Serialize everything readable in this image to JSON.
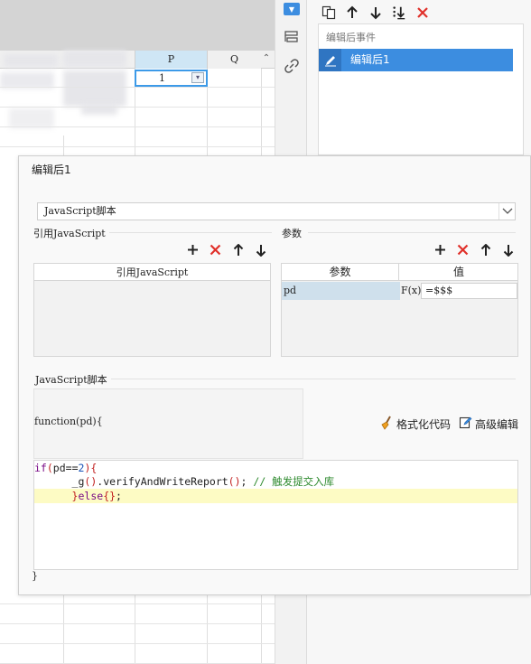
{
  "sheet": {
    "columns": [
      "P",
      "Q"
    ],
    "active_cell_value": "1",
    "scroll_up_glyph": "⌃"
  },
  "side_toolbar": {
    "icons": [
      "dropdown-widget-icon",
      "layers-icon",
      "link-icon"
    ]
  },
  "event_panel": {
    "toolbar_icons": [
      "copy-icon",
      "move-up-icon",
      "move-down-icon",
      "move-bottom-icon",
      "delete-icon"
    ],
    "header": "编辑后事件",
    "items": [
      {
        "label": "编辑后1"
      }
    ]
  },
  "dialog": {
    "title": "编辑后1",
    "type_select": {
      "value": "JavaScript脚本"
    },
    "ref_section": {
      "label": "引用JavaScript",
      "column_header": "引用JavaScript",
      "tools": [
        "+",
        "✕",
        "↑",
        "↓"
      ]
    },
    "param_section": {
      "label": "参数",
      "column_headers": [
        "参数",
        "值"
      ],
      "rows": [
        {
          "name": "pd",
          "fx": "F(x)",
          "value": "=$$$"
        }
      ],
      "tools": [
        "+",
        "✕",
        "↑",
        "↓"
      ]
    },
    "script_section": {
      "label": "JavaScript脚本",
      "function_signature": "function(pd){",
      "format_button": "格式化代码",
      "advanced_button": "高级编辑",
      "closing": "}"
    },
    "code": {
      "line1": {
        "kw": "if",
        "p1": "(",
        "t1": "pd==",
        "n1": "2",
        "p2": "){"
      },
      "line2": {
        "indent": "      ",
        "t1": "_g",
        "p1": "()",
        "t2": ".verifyAndWriteReport",
        "p2": "()",
        "t3": "; ",
        "comment": "// 触发提交入库"
      },
      "line3": {
        "indent": "      ",
        "p1": "}",
        "kw": "else",
        "p2": "{}",
        "t1": ";"
      }
    }
  },
  "colors": {
    "accent": "#3c8de0",
    "delete_red": "#e0302a",
    "highlight_line": "#fdfbc4"
  }
}
